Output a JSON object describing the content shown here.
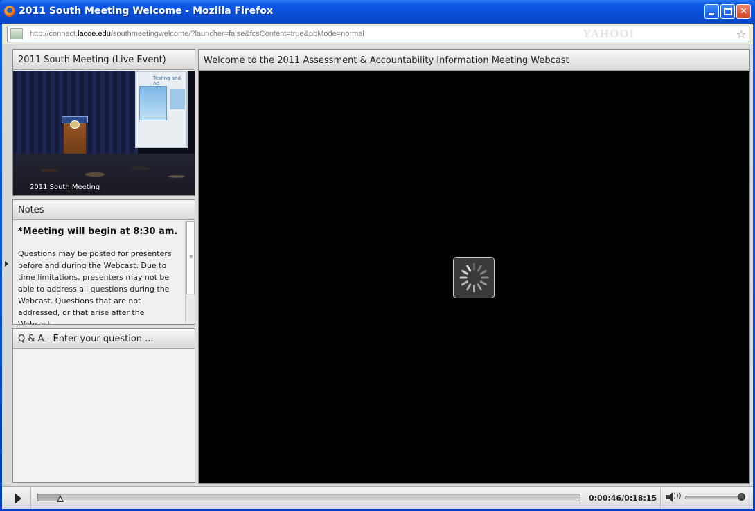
{
  "window": {
    "title": "2011 South Meeting Welcome - Mozilla Firefox",
    "minimize_label": "",
    "maximize_label": "",
    "close_label": "✕"
  },
  "urlbar": {
    "url_prefix": "http://connect.",
    "url_host": "lacoe.edu",
    "url_path": "/southmeetingwelcome/?launcher=false&fcsContent=true&pbMode=normal",
    "search_brand": "YAHOO!"
  },
  "video_pod": {
    "title": "2011 South Meeting (Live Event)",
    "caption": "2011 South Meeting",
    "screen_text": "Testing and Ac"
  },
  "notes_pod": {
    "title": "Notes",
    "heading": "*Meeting will begin at 8:30 am.",
    "body": "Questions may be posted for presenters before and during the Webcast. Due to time limitations, presenters may not be able to address all questions during the Webcast. Questions that are not addressed, or that arise after the Webcast,"
  },
  "qa_pod": {
    "title": "Q & A  - Enter your question ..."
  },
  "stage": {
    "title": "Welcome to the 2011 Assessment & Accountability Information Meeting Webcast",
    "status": "loading"
  },
  "controls": {
    "time": "0:00:46/0:18:15",
    "progress_fraction": 0.042,
    "volume_fraction": 1.0
  },
  "icons": {
    "app": "firefox-icon",
    "site": "site-identity-icon",
    "bookmark": "star-icon",
    "loading": "spinner-icon",
    "play": "play-icon",
    "volume": "speaker-icon"
  }
}
